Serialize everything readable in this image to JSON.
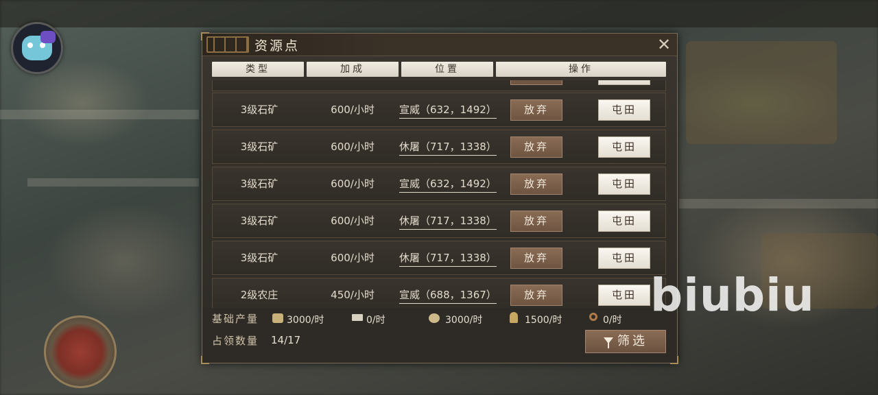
{
  "panel": {
    "title": "资源点",
    "close_label": "✕"
  },
  "table": {
    "headers": [
      "类型",
      "加成",
      "位置",
      "操作"
    ],
    "rows": [
      {
        "type": "",
        "bonus": "",
        "position": "",
        "abandon": "",
        "farm": ""
      },
      {
        "type": "3级石矿",
        "bonus": "600/小时",
        "position": "宣威（632，1492）",
        "abandon": "放弃",
        "farm": "屯田"
      },
      {
        "type": "3级石矿",
        "bonus": "600/小时",
        "position": "休屠（717，1338）",
        "abandon": "放弃",
        "farm": "屯田"
      },
      {
        "type": "3级石矿",
        "bonus": "600/小时",
        "position": "宣威（632，1492）",
        "abandon": "放弃",
        "farm": "屯田"
      },
      {
        "type": "3级石矿",
        "bonus": "600/小时",
        "position": "休屠（717，1338）",
        "abandon": "放弃",
        "farm": "屯田"
      },
      {
        "type": "3级石矿",
        "bonus": "600/小时",
        "position": "休屠（717，1338）",
        "abandon": "放弃",
        "farm": "屯田"
      },
      {
        "type": "2级农庄",
        "bonus": "450/小时",
        "position": "宣威（688，1367）",
        "abandon": "放弃",
        "farm": "屯田"
      }
    ]
  },
  "footer": {
    "base_output_label": "基础产量",
    "resources": [
      {
        "icon": "wood-icon",
        "value": "3000/时",
        "color": "#c9b27a"
      },
      {
        "icon": "iron-icon",
        "value": "0/时",
        "color": "#d8d2c2"
      },
      {
        "icon": "stone-icon",
        "value": "3000/时",
        "color": "#cdb98a"
      },
      {
        "icon": "grain-icon",
        "value": "1500/时",
        "color": "#c8a860"
      },
      {
        "icon": "copper-icon",
        "value": "0/时",
        "color": "#b07a4a"
      }
    ],
    "occupied_label": "占领数量",
    "occupied_value": "14/17",
    "filter_label": "筛选"
  },
  "watermark": "biubiu"
}
